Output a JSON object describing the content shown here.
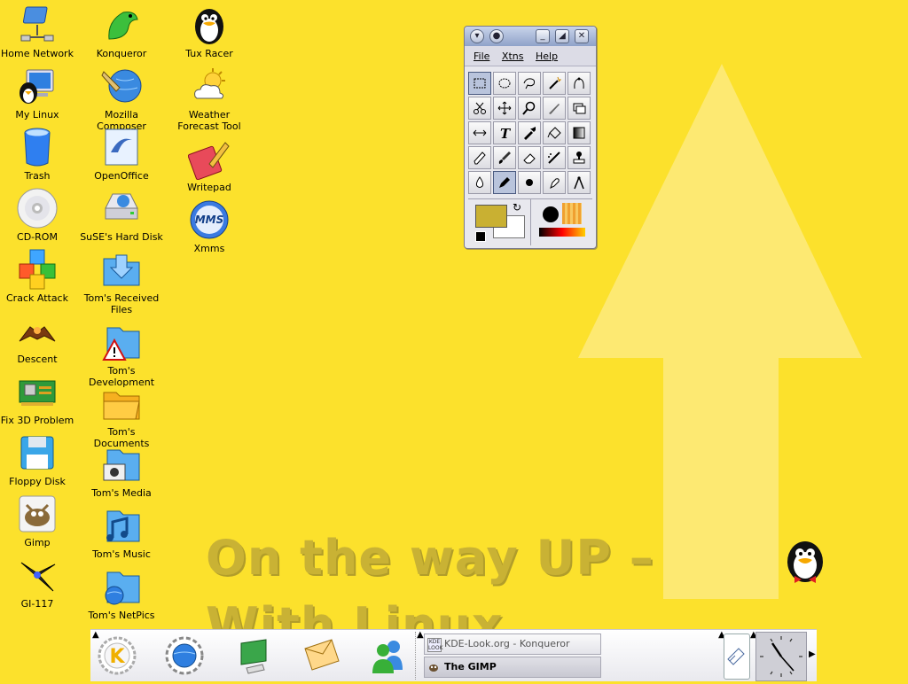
{
  "wallpaper": {
    "slogan": "On the way UP – With Linux"
  },
  "desktop": {
    "icons": [
      {
        "label": "Home Network"
      },
      {
        "label": "My Linux"
      },
      {
        "label": "Trash"
      },
      {
        "label": "CD-ROM"
      },
      {
        "label": "Crack Attack"
      },
      {
        "label": "Descent"
      },
      {
        "label": "Fix 3D Problem"
      },
      {
        "label": "Floppy Disk"
      },
      {
        "label": "Gimp"
      },
      {
        "label": "GI-117"
      },
      {
        "label": "Konqueror"
      },
      {
        "label": "Mozilla Composer"
      },
      {
        "label": "OpenOffice"
      },
      {
        "label": "SuSE's Hard Disk"
      },
      {
        "label": "Tom's  Received Files"
      },
      {
        "label": "Tom's Development"
      },
      {
        "label": "Tom's Documents"
      },
      {
        "label": "Tom's Media"
      },
      {
        "label": "Tom's Music"
      },
      {
        "label": "Tom's NetPics"
      },
      {
        "label": "Tux Racer"
      },
      {
        "label": "Weather Forecast Tool"
      },
      {
        "label": "Writepad"
      },
      {
        "label": "Xmms"
      }
    ]
  },
  "gimp": {
    "menu": {
      "file": "File",
      "xtns": "Xtns",
      "help": "Help"
    },
    "title_buttons": {
      "menu": "▾",
      "sticky": "●",
      "minimize": "_",
      "maximize": "◢",
      "close": "✕"
    },
    "fg_color": "#c9b032",
    "bg_color": "#ffffff"
  },
  "taskbar": {
    "tasks": [
      {
        "label": "KDE-Look.org - Konqueror",
        "icon_text": "KDE LOOK"
      },
      {
        "label": "The GIMP"
      }
    ]
  }
}
